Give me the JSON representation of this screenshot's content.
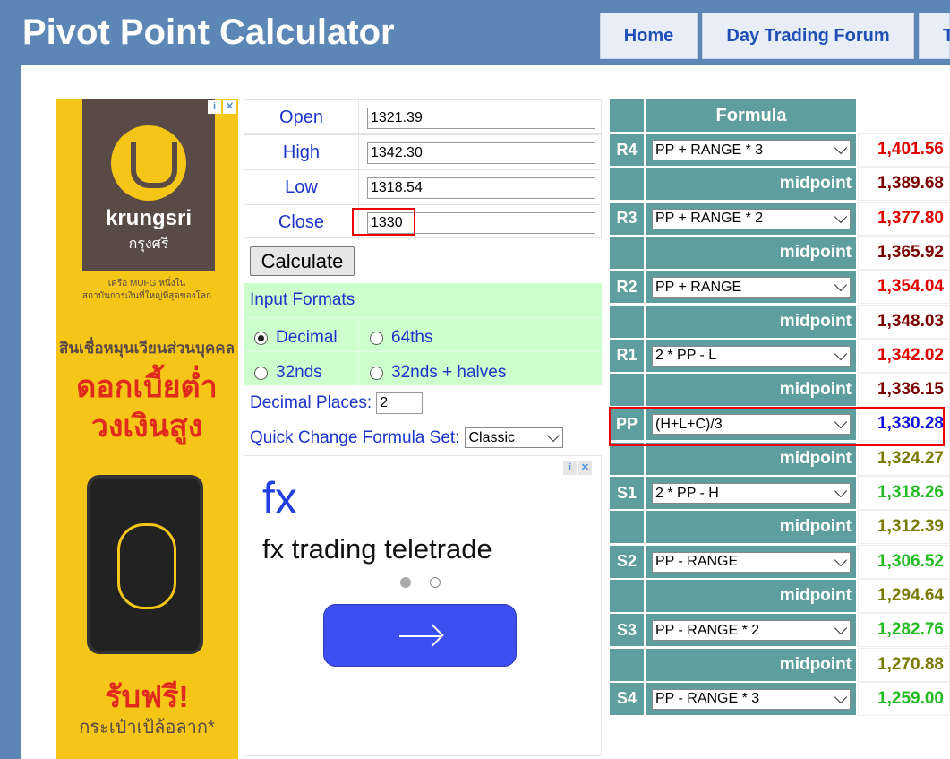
{
  "header": {
    "title": "Pivot Point Calculator",
    "nav": [
      "Home",
      "Day Trading Forum",
      "T"
    ]
  },
  "ad_left": {
    "ad_icon_info": "i",
    "ad_icon_close": "✕",
    "brand": "krungsri",
    "brand_th": "กรุงศรี",
    "mufg_line1": "เครือ MUFG หนึ่งใน",
    "mufg_line2": "สถาบันการเงินที่ใหญ่ที่สุดของโลก",
    "tagline1": "สินเชื่อหมุนเวียนส่วนบุคคล",
    "tagline2a": "ดอกเบี้ยต่ำ",
    "tagline2b": "วงเงินสูง",
    "free": "รับฟรี!",
    "bottom": "กระเป๋าเป้ล้อลาก*"
  },
  "inputs": {
    "open_label": "Open",
    "open_value": "1321.39",
    "high_label": "High",
    "high_value": "1342.30",
    "low_label": "Low",
    "low_value": "1318.54",
    "close_label": "Close",
    "close_value": "1330",
    "calculate_label": "Calculate",
    "formats_label": "Input Formats",
    "formats": {
      "decimal": "Decimal",
      "sixtyfourths": "64ths",
      "thirtyseconds": "32nds",
      "thirtyseconds_halves": "32nds + halves"
    },
    "decimal_places_label": "Decimal Places:",
    "decimal_places_value": "2",
    "quick_change_label": "Quick Change Formula Set:",
    "quick_change_value": "Classic"
  },
  "ad_mid": {
    "ad_icon_info": "i",
    "ad_icon_close": "✕",
    "fx": "fx",
    "text": "fx trading teletrade"
  },
  "results": {
    "header": "Formula",
    "midpoint": "midpoint",
    "rows": [
      {
        "label": "R4",
        "formula": "PP + RANGE * 3",
        "value": "1,401.56",
        "color": "#e00000"
      },
      {
        "label": "",
        "formula": "",
        "value": "1,389.68",
        "color": "#7a0000"
      },
      {
        "label": "R3",
        "formula": "PP + RANGE * 2",
        "value": "1,377.80",
        "color": "#e00000"
      },
      {
        "label": "",
        "formula": "",
        "value": "1,365.92",
        "color": "#7a0000"
      },
      {
        "label": "R2",
        "formula": "PP + RANGE",
        "value": "1,354.04",
        "color": "#e00000"
      },
      {
        "label": "",
        "formula": "",
        "value": "1,348.03",
        "color": "#7a0000"
      },
      {
        "label": "R1",
        "formula": "2 * PP - L",
        "value": "1,342.02",
        "color": "#e00000"
      },
      {
        "label": "",
        "formula": "",
        "value": "1,336.15",
        "color": "#7a0000"
      },
      {
        "label": "PP",
        "formula": "(H+L+C)/3",
        "value": "1,330.28",
        "color": "#1010e0"
      },
      {
        "label": "",
        "formula": "",
        "value": "1,324.27",
        "color": "#7a7a00"
      },
      {
        "label": "S1",
        "formula": "2 * PP - H",
        "value": "1,318.26",
        "color": "#22bb22"
      },
      {
        "label": "",
        "formula": "",
        "value": "1,312.39",
        "color": "#7a7a00"
      },
      {
        "label": "S2",
        "formula": "PP - RANGE",
        "value": "1,306.52",
        "color": "#22bb22"
      },
      {
        "label": "",
        "formula": "",
        "value": "1,294.64",
        "color": "#7a7a00"
      },
      {
        "label": "S3",
        "formula": "PP - RANGE * 2",
        "value": "1,282.76",
        "color": "#22bb22"
      },
      {
        "label": "",
        "formula": "",
        "value": "1,270.88",
        "color": "#7a7a00"
      },
      {
        "label": "S4",
        "formula": "PP - RANGE * 3",
        "value": "1,259.00",
        "color": "#22bb22"
      }
    ]
  }
}
